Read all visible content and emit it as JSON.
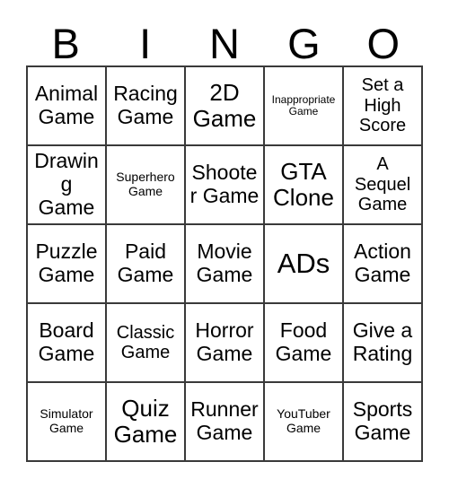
{
  "card": {
    "title": "Bingo Card",
    "header_letters": [
      "B",
      "I",
      "N",
      "G",
      "O"
    ],
    "columns": 5,
    "rows": 5,
    "border_color": "#3a3a3a",
    "background_color": "#ffffff",
    "text_color": "#000000",
    "cells": [
      {
        "text": "Animal Game",
        "size": "md"
      },
      {
        "text": "Racing Game",
        "size": "md"
      },
      {
        "text": "2D Game",
        "size": "lg"
      },
      {
        "text": "Inappropriate Game",
        "size": "xxs"
      },
      {
        "text": "Set a High Score",
        "size": "sm"
      },
      {
        "text": "Drawing Game",
        "size": "md"
      },
      {
        "text": "Superhero Game",
        "size": "xs"
      },
      {
        "text": "Shooter Game",
        "size": "md"
      },
      {
        "text": "GTA Clone",
        "size": "lg"
      },
      {
        "text": "A Sequel Game",
        "size": "sm"
      },
      {
        "text": "Puzzle Game",
        "size": "md"
      },
      {
        "text": "Paid Game",
        "size": "md"
      },
      {
        "text": "Movie Game",
        "size": "md"
      },
      {
        "text": "ADs",
        "size": "xl"
      },
      {
        "text": "Action Game",
        "size": "md"
      },
      {
        "text": "Board Game",
        "size": "md"
      },
      {
        "text": "Classic Game",
        "size": "sm"
      },
      {
        "text": "Horror Game",
        "size": "md"
      },
      {
        "text": "Food Game",
        "size": "md"
      },
      {
        "text": "Give a Rating",
        "size": "md"
      },
      {
        "text": "Simulator Game",
        "size": "xs"
      },
      {
        "text": "Quiz Game",
        "size": "lg"
      },
      {
        "text": "Runner Game",
        "size": "md"
      },
      {
        "text": "YouTuber Game",
        "size": "xs"
      },
      {
        "text": "Sports Game",
        "size": "md"
      }
    ]
  }
}
